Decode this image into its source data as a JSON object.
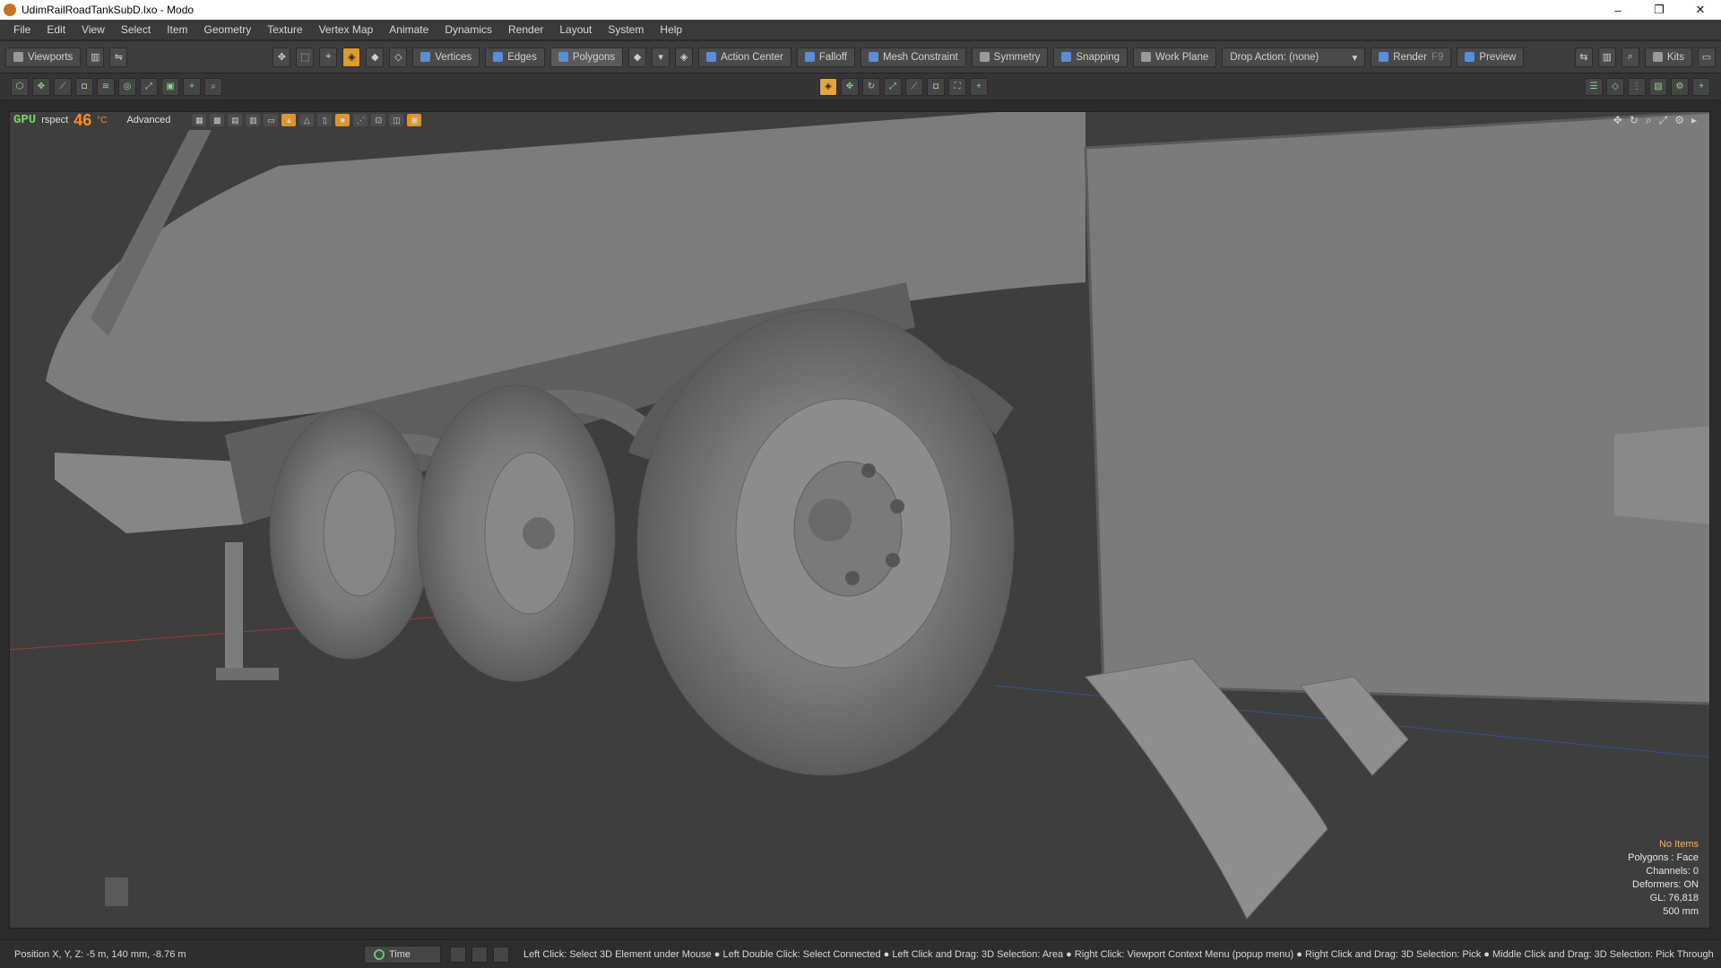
{
  "window": {
    "title": "UdimRailRoadTankSubD.lxo - Modo",
    "controls": [
      "–",
      "❐",
      "✕"
    ]
  },
  "menu": [
    "File",
    "Edit",
    "View",
    "Select",
    "Item",
    "Geometry",
    "Texture",
    "Vertex Map",
    "Animate",
    "Dynamics",
    "Render",
    "Layout",
    "System",
    "Help"
  ],
  "toolbar": {
    "viewports": "Viewports",
    "vertices": "Vertices",
    "edges": "Edges",
    "polygons": "Polygons",
    "action_center": "Action Center",
    "falloff": "Falloff",
    "mesh_constraint": "Mesh Constraint",
    "symmetry": "Symmetry",
    "snapping": "Snapping",
    "work_plane": "Work Plane",
    "drop_action": "Drop Action: (none)",
    "render": "Render",
    "render_shortcut": "F9",
    "preview": "Preview",
    "kits": "Kits"
  },
  "viewport": {
    "gpu": "GPU",
    "name": "rspect",
    "temperature": "46",
    "temperature_unit": "°C",
    "style": "Advanced"
  },
  "info": {
    "no_items": "No Items",
    "polygons": "Polygons : Face",
    "channels": "Channels: 0",
    "deformers": "Deformers: ON",
    "gl": "GL: 76,818",
    "size": "500 mm"
  },
  "status": {
    "position": "Position X, Y, Z:   -5 m, 140 mm, -8.76 m",
    "time": "Time",
    "hints": "Left Click: Select 3D Element under Mouse ● Left Double Click: Select Connected ● Left Click and Drag: 3D Selection: Area ● Right Click: Viewport Context Menu (popup menu) ● Right Click and Drag: 3D Selection: Pick ● Middle Click and Drag: 3D Selection: Pick Through"
  },
  "colors": {
    "accent_orange": "#e09a2a",
    "gpu_green": "#7ad060",
    "temp_orange": "#ff8c1a",
    "info_orange": "#ffb040"
  }
}
